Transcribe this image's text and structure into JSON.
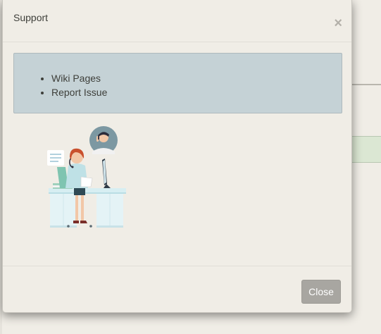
{
  "modal": {
    "title": "Support",
    "close_symbol": "×",
    "links": [
      {
        "label": "Wiki Pages"
      },
      {
        "label": "Report Issue"
      }
    ],
    "illustration_icon": "customer-support-agent-illustration",
    "close_button_label": "Close"
  },
  "colors": {
    "info_box_bg": "#c5d2d6",
    "button_bg": "#a8a6a1",
    "page_bg": "#f0ede6"
  }
}
